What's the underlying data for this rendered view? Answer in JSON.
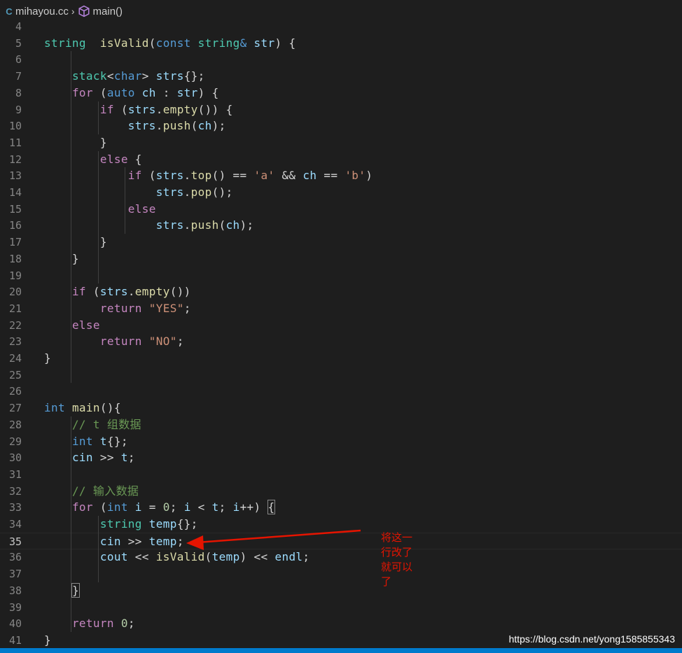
{
  "breadcrumb": {
    "file": "mihayou.cc",
    "symbol": "main()"
  },
  "lines": [
    {
      "n": "4",
      "tokens": []
    },
    {
      "n": "5",
      "tokens": [
        [
          "ty",
          "string"
        ],
        [
          "",
          "  "
        ],
        [
          "fn",
          "isValid"
        ],
        [
          "",
          "("
        ],
        [
          "bl",
          "const"
        ],
        [
          "",
          " "
        ],
        [
          "ty",
          "string"
        ],
        [
          "bl",
          "&"
        ],
        [
          "",
          " "
        ],
        [
          "vr",
          "str"
        ],
        [
          "",
          ") {"
        ]
      ]
    },
    {
      "n": "6",
      "tokens": []
    },
    {
      "n": "7",
      "tokens": [
        [
          "",
          "    "
        ],
        [
          "ty",
          "stack"
        ],
        [
          "",
          "<"
        ],
        [
          "bl",
          "char"
        ],
        [
          "",
          "> "
        ],
        [
          "vr",
          "strs"
        ],
        [
          "",
          "{};"
        ]
      ]
    },
    {
      "n": "8",
      "tokens": [
        [
          "",
          "    "
        ],
        [
          "kw",
          "for"
        ],
        [
          "",
          " ("
        ],
        [
          "bl",
          "auto"
        ],
        [
          "",
          " "
        ],
        [
          "vr",
          "ch"
        ],
        [
          "",
          " : "
        ],
        [
          "vr",
          "str"
        ],
        [
          "",
          ") {"
        ]
      ]
    },
    {
      "n": "9",
      "tokens": [
        [
          "",
          "        "
        ],
        [
          "kw",
          "if"
        ],
        [
          "",
          " ("
        ],
        [
          "vr",
          "strs"
        ],
        [
          "",
          "."
        ],
        [
          "fn",
          "empty"
        ],
        [
          "",
          "()) {"
        ]
      ]
    },
    {
      "n": "10",
      "tokens": [
        [
          "",
          "            "
        ],
        [
          "vr",
          "strs"
        ],
        [
          "",
          "."
        ],
        [
          "fn",
          "push"
        ],
        [
          "",
          "("
        ],
        [
          "vr",
          "ch"
        ],
        [
          "",
          ");"
        ]
      ]
    },
    {
      "n": "11",
      "tokens": [
        [
          "",
          "        }"
        ]
      ]
    },
    {
      "n": "12",
      "tokens": [
        [
          "",
          "        "
        ],
        [
          "kw",
          "else"
        ],
        [
          "",
          " {"
        ]
      ]
    },
    {
      "n": "13",
      "tokens": [
        [
          "",
          "            "
        ],
        [
          "kw",
          "if"
        ],
        [
          "",
          " ("
        ],
        [
          "vr",
          "strs"
        ],
        [
          "",
          "."
        ],
        [
          "fn",
          "top"
        ],
        [
          "",
          "() == "
        ],
        [
          "st",
          "'a'"
        ],
        [
          "",
          " && "
        ],
        [
          "vr",
          "ch"
        ],
        [
          "",
          " == "
        ],
        [
          "st",
          "'b'"
        ],
        [
          "",
          ")"
        ]
      ]
    },
    {
      "n": "14",
      "tokens": [
        [
          "",
          "                "
        ],
        [
          "vr",
          "strs"
        ],
        [
          "",
          "."
        ],
        [
          "fn",
          "pop"
        ],
        [
          "",
          "();"
        ]
      ]
    },
    {
      "n": "15",
      "tokens": [
        [
          "",
          "            "
        ],
        [
          "kw",
          "else"
        ]
      ]
    },
    {
      "n": "16",
      "tokens": [
        [
          "",
          "                "
        ],
        [
          "vr",
          "strs"
        ],
        [
          "",
          "."
        ],
        [
          "fn",
          "push"
        ],
        [
          "",
          "("
        ],
        [
          "vr",
          "ch"
        ],
        [
          "",
          ");"
        ]
      ]
    },
    {
      "n": "17",
      "tokens": [
        [
          "",
          "        }"
        ]
      ]
    },
    {
      "n": "18",
      "tokens": [
        [
          "",
          "    }"
        ]
      ]
    },
    {
      "n": "19",
      "tokens": []
    },
    {
      "n": "20",
      "tokens": [
        [
          "",
          "    "
        ],
        [
          "kw",
          "if"
        ],
        [
          "",
          " ("
        ],
        [
          "vr",
          "strs"
        ],
        [
          "",
          "."
        ],
        [
          "fn",
          "empty"
        ],
        [
          "",
          "())"
        ]
      ]
    },
    {
      "n": "21",
      "tokens": [
        [
          "",
          "        "
        ],
        [
          "kw",
          "return"
        ],
        [
          "",
          " "
        ],
        [
          "st",
          "\"YES\""
        ],
        [
          "",
          ";"
        ]
      ]
    },
    {
      "n": "22",
      "tokens": [
        [
          "",
          "    "
        ],
        [
          "kw",
          "else"
        ]
      ]
    },
    {
      "n": "23",
      "tokens": [
        [
          "",
          "        "
        ],
        [
          "kw",
          "return"
        ],
        [
          "",
          " "
        ],
        [
          "st",
          "\"NO\""
        ],
        [
          "",
          ";"
        ]
      ]
    },
    {
      "n": "24",
      "tokens": [
        [
          "",
          "}"
        ]
      ]
    },
    {
      "n": "25",
      "tokens": []
    },
    {
      "n": "26",
      "tokens": []
    },
    {
      "n": "27",
      "tokens": [
        [
          "bl",
          "int"
        ],
        [
          "",
          " "
        ],
        [
          "fn",
          "main"
        ],
        [
          "",
          "(){"
        ]
      ]
    },
    {
      "n": "28",
      "tokens": [
        [
          "",
          "    "
        ],
        [
          "cm",
          "// t 组数据"
        ]
      ]
    },
    {
      "n": "29",
      "tokens": [
        [
          "",
          "    "
        ],
        [
          "bl",
          "int"
        ],
        [
          "",
          " "
        ],
        [
          "vr",
          "t"
        ],
        [
          "",
          "{};"
        ]
      ]
    },
    {
      "n": "30",
      "tokens": [
        [
          "",
          "    "
        ],
        [
          "vr",
          "cin"
        ],
        [
          "",
          " >> "
        ],
        [
          "vr",
          "t"
        ],
        [
          "",
          ";"
        ]
      ]
    },
    {
      "n": "31",
      "tokens": []
    },
    {
      "n": "32",
      "tokens": [
        [
          "",
          "    "
        ],
        [
          "cm",
          "// 输入数据"
        ]
      ]
    },
    {
      "n": "33",
      "tokens": [
        [
          "",
          "    "
        ],
        [
          "kw",
          "for"
        ],
        [
          "",
          " ("
        ],
        [
          "bl",
          "int"
        ],
        [
          "",
          " "
        ],
        [
          "vr",
          "i"
        ],
        [
          "",
          " = "
        ],
        [
          "nm",
          "0"
        ],
        [
          "",
          "; "
        ],
        [
          "vr",
          "i"
        ],
        [
          "",
          " < "
        ],
        [
          "vr",
          "t"
        ],
        [
          "",
          "; "
        ],
        [
          "vr",
          "i"
        ],
        [
          "",
          "++) "
        ],
        [
          "br",
          "{"
        ]
      ]
    },
    {
      "n": "34",
      "tokens": [
        [
          "",
          "        "
        ],
        [
          "ty",
          "string"
        ],
        [
          "",
          " "
        ],
        [
          "vr",
          "temp"
        ],
        [
          "",
          "{};"
        ]
      ]
    },
    {
      "n": "35",
      "tokens": [
        [
          "",
          "        "
        ],
        [
          "vr",
          "cin"
        ],
        [
          "",
          " >> "
        ],
        [
          "vr",
          "temp"
        ],
        [
          "",
          ";"
        ]
      ],
      "current": true
    },
    {
      "n": "36",
      "tokens": [
        [
          "",
          "        "
        ],
        [
          "vr",
          "cout"
        ],
        [
          "",
          " << "
        ],
        [
          "fn",
          "isValid"
        ],
        [
          "",
          "("
        ],
        [
          "vr",
          "temp"
        ],
        [
          "",
          ") << "
        ],
        [
          "vr",
          "endl"
        ],
        [
          "",
          ";"
        ]
      ]
    },
    {
      "n": "37",
      "tokens": []
    },
    {
      "n": "38",
      "tokens": [
        [
          "",
          "    "
        ],
        [
          "br",
          "}"
        ]
      ]
    },
    {
      "n": "39",
      "tokens": []
    },
    {
      "n": "40",
      "tokens": [
        [
          "",
          "    "
        ],
        [
          "kw",
          "return"
        ],
        [
          "",
          " "
        ],
        [
          "nm",
          "0"
        ],
        [
          "",
          ";"
        ]
      ]
    },
    {
      "n": "41",
      "tokens": [
        [
          "",
          "}"
        ]
      ]
    }
  ],
  "annotation": {
    "text": "将这一行改了就可以了"
  },
  "watermark": "https://blog.csdn.net/yong1585855343",
  "colors": {
    "background": "#1e1e1e",
    "keyword": "#c586c0",
    "type": "#4ec9b0",
    "builtin": "#569cd6",
    "function": "#dcdcaa",
    "variable": "#9cdcfe",
    "string": "#ce9178",
    "number": "#b5cea8",
    "comment": "#6a9955",
    "annotation": "#e51400",
    "statusbar": "#007acc"
  }
}
